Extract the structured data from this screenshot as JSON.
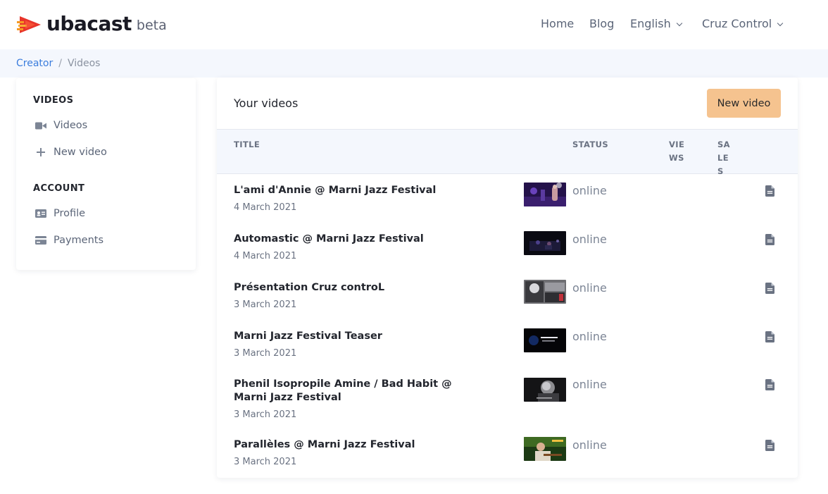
{
  "brand": {
    "name": "ubacast",
    "badge": "beta",
    "colors": {
      "red": "#e8352b",
      "orange": "#f59a23"
    }
  },
  "nav": {
    "home": "Home",
    "blog": "Blog",
    "language": "English",
    "account": "Cruz Control"
  },
  "breadcrumb": {
    "root": "Creator",
    "separator": "/",
    "current": "Videos"
  },
  "sidebar": {
    "videos_heading": "VIDEOS",
    "videos_link": "Videos",
    "new_video_link": "New video",
    "account_heading": "ACCOUNT",
    "profile_link": "Profile",
    "payments_link": "Payments"
  },
  "main": {
    "title": "Your videos",
    "new_video_button": "New video",
    "accent": "#f5c38f",
    "columns": {
      "title": "TITLE",
      "status": "STATUS",
      "views": "VIEWS",
      "sales": "SALES"
    }
  },
  "videos": [
    {
      "title": "L'ami d'Annie @ Marni Jazz Festival",
      "date": "4 March 2021",
      "status": "online",
      "thumb": "stage-purple"
    },
    {
      "title": "Automastic @ Marni Jazz Festival",
      "date": "4 March 2021",
      "status": "online",
      "thumb": "stage-dark"
    },
    {
      "title": "Présentation Cruz controL",
      "date": "3 March 2021",
      "status": "online",
      "thumb": "grey-collage"
    },
    {
      "title": "Marni Jazz Festival Teaser",
      "date": "3 March 2021",
      "status": "online",
      "thumb": "black-title"
    },
    {
      "title": "Phenil Isopropile Amine / Bad Habit @ Marni Jazz Festival",
      "date": "3 March 2021",
      "status": "online",
      "thumb": "bw-portrait"
    },
    {
      "title": "Parallèles @ Marni Jazz Festival",
      "date": "3 March 2021",
      "status": "online",
      "thumb": "green-guitar"
    }
  ]
}
